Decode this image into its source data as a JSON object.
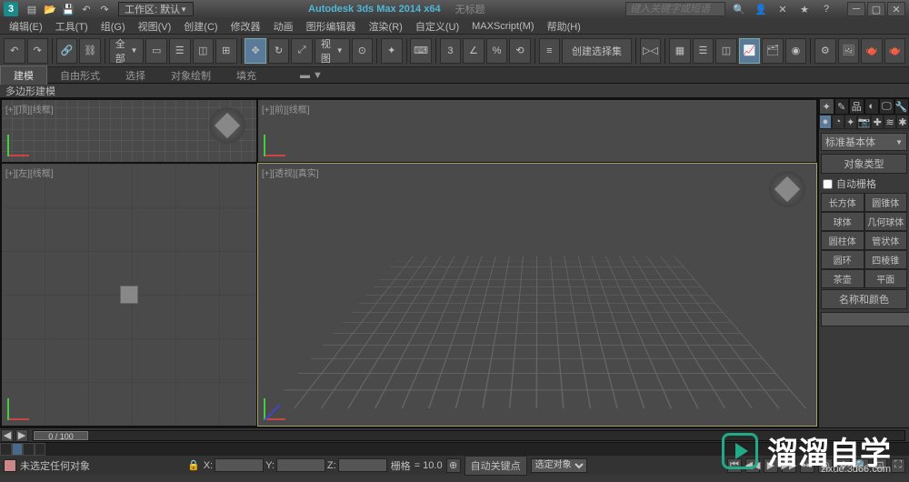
{
  "title": {
    "app": "Autodesk 3ds Max 2014 x64",
    "doc": "无标题",
    "workspace_label": "工作区: 默认",
    "search_placeholder": "键入关键字或短语"
  },
  "menu": [
    "编辑(E)",
    "工具(T)",
    "组(G)",
    "视图(V)",
    "创建(C)",
    "修改器",
    "动画",
    "图形编辑器",
    "渲染(R)",
    "自定义(U)",
    "MAXScript(M)",
    "帮助(H)"
  ],
  "toolbar": {
    "all": "全部",
    "view": "视图",
    "namedset": "创建选择集"
  },
  "tabs": [
    "建模",
    "自由形式",
    "选择",
    "对象绘制",
    "填充"
  ],
  "ribbon_label": "多边形建模",
  "viewports": {
    "top": "[+][顶][线框]",
    "front": "[+][前][线框]",
    "left": "[+][左][线框]",
    "persp": "[+][透视][真实]"
  },
  "cmdpanel": {
    "category": "标准基本体",
    "rollout_type": "对象类型",
    "autogrid": "自动栅格",
    "buttons": [
      [
        "长方体",
        "圆锥体"
      ],
      [
        "球体",
        "几何球体"
      ],
      [
        "圆柱体",
        "管状体"
      ],
      [
        "圆环",
        "四棱锥"
      ],
      [
        "茶壶",
        "平面"
      ]
    ],
    "rollout_name": "名称和颜色"
  },
  "timeline": {
    "frame": "0 / 100"
  },
  "status": {
    "msg": "未选定任何对象",
    "x": "",
    "y": "",
    "z": "",
    "grid_label": "栅格",
    "grid_val": "= 10.0",
    "autokey": "自动关键点",
    "filter": "选定对象"
  },
  "watermark": {
    "brand": "溜溜自学",
    "url": "zixue.3d66.com"
  }
}
